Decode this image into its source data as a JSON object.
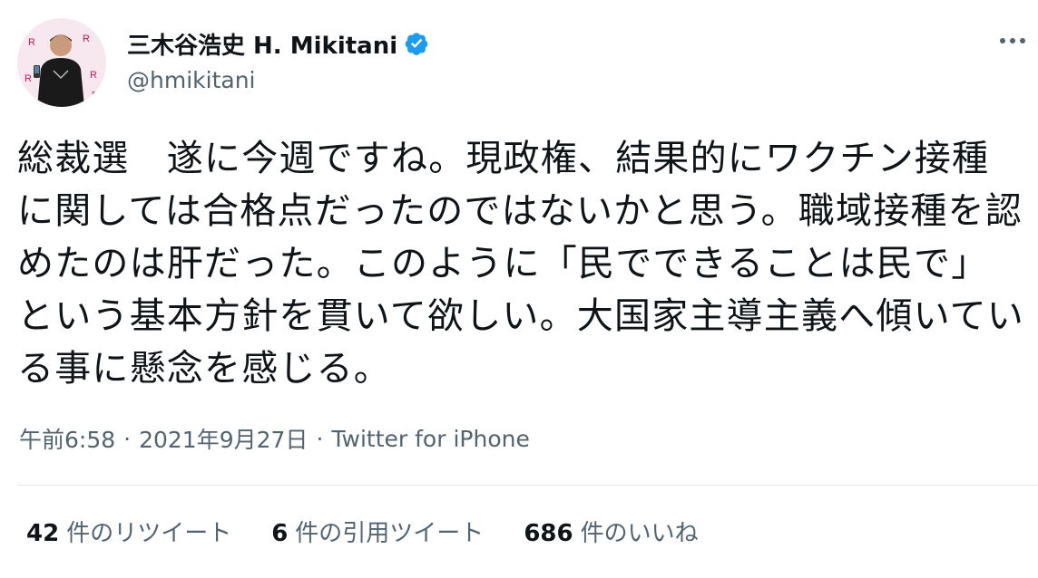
{
  "author": {
    "display_name": "三木谷浩史 H. Mikitani",
    "handle": "@hmikitani",
    "verified": true
  },
  "tweet": {
    "text": "総裁選　遂に今週ですね。現政権、結果的にワクチン接種に関しては合格点だったのではないかと思う。職域接種を認めたのは肝だった。このように「民でできることは民で」という基本方針を貫いて欲しい。大国家主導主義へ傾いている事に懸念を感じる。",
    "time": "午前6:58",
    "date": "2021年9月27日",
    "separator": "·",
    "source": "Twitter for iPhone"
  },
  "stats": {
    "retweets": {
      "count": "42",
      "label": "件のリツイート"
    },
    "quotes": {
      "count": "6",
      "label": "件の引用ツイート"
    },
    "likes": {
      "count": "686",
      "label": "件のいいね"
    }
  },
  "colors": {
    "text_primary": "#0f1419",
    "text_secondary": "#536471",
    "verified_blue": "#1d9bf0",
    "divider": "#e4e8eb"
  },
  "icons": {
    "verified": "verified-badge-icon",
    "more": "more-options-icon"
  }
}
